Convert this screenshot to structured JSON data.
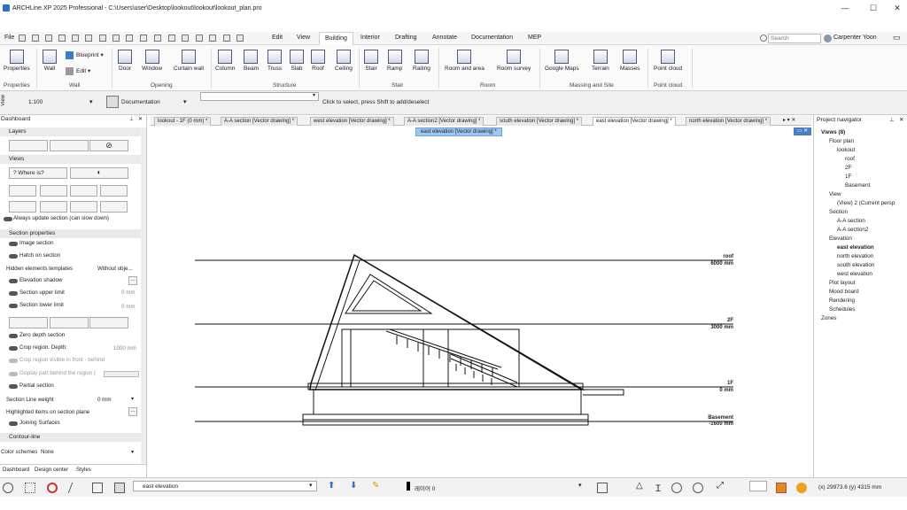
{
  "title": "ARCHLine.XP 2025 Professional - C:\\Users\\user\\Desktop\\lookout\\lookout\\lookout_plan.pro",
  "menu": {
    "file": "File",
    "items": [
      "Edit",
      "View",
      "Building",
      "Interior",
      "Drafting",
      "Annotate",
      "Documentation",
      "MEP"
    ],
    "active": "Building"
  },
  "search": {
    "placeholder": "Search"
  },
  "user": "Carpenter Yoon",
  "ribbon": {
    "buttons": [
      "Properties",
      "Wall",
      "Blueprint",
      "Edit",
      "Door",
      "Window",
      "Curtain wall",
      "Column",
      "Beam",
      "Truss",
      "Slab",
      "Roof",
      "Ceiling",
      "Stair",
      "Ramp",
      "Railing",
      "Room and area",
      "Room survey",
      "Google Maps",
      "Terrain",
      "Masses",
      "Point cloud"
    ],
    "groups": [
      "Properties",
      "Wall",
      "Opening",
      "Structure",
      "Stair",
      "Room",
      "Massing and Site",
      "Point cloud"
    ]
  },
  "viewbar": {
    "side": "View",
    "scale": "1:100",
    "layer": "Documentation",
    "hint": "Click to select, press Shift to add/deselect"
  },
  "left": {
    "title": "Dashboard",
    "layers": "Layers",
    "views": "Views",
    "where_is": "Where is?",
    "always_update": "Always update section (can slow down)",
    "section_properties": "Section properties",
    "image_section": "Image section",
    "hatch_section": "Hatch on section",
    "hidden_templates": "Hidden elements templates",
    "without": "Without obje...",
    "elevation_shadow": "Elevation shadow",
    "upper": "Section upper limit",
    "upper_val": "0 mm",
    "lower": "Section lower limit",
    "lower_val": "0 mm",
    "zero_depth": "Zero depth section",
    "crop_depth": "Crop region. Depth:",
    "crop_val": "1000 mm",
    "crop_visible": "Crop region visible in front - behind",
    "display_part": "Display part behind the region (",
    "partial": "Partial section",
    "line_weight": "Section Line weight",
    "lw_val": "0 mm",
    "highlighted": "Highlighted items on section plane",
    "joining": "Joining Surfaces",
    "contour": "Contour-line",
    "color_schemes": "Color schemes",
    "cs_val": "None",
    "tabs": [
      "Dashboard",
      "Design center",
      "Styles"
    ]
  },
  "doc_tabs": [
    "lookout - 1F (0 mm) *",
    "A-A section [Vector drawing] *",
    "west elevation [Vector drawing] *",
    "A-A section2 [Vector drawing] *",
    "south elevation [Vector drawing] *",
    "east elevation [Vector drawing] *",
    "north elevation [Vector drawing] *"
  ],
  "active_tab_label": "east elevation [Vector drawing] *",
  "levels": [
    {
      "name": "roof",
      "elev": "6000 mm"
    },
    {
      "name": "2F",
      "elev": "3000 mm"
    },
    {
      "name": "1F",
      "elev": "0 mm"
    },
    {
      "name": "Basement",
      "elev": "-1600 mm"
    }
  ],
  "navigator": {
    "title": "Project navigator",
    "items": [
      {
        "label": "Views (8)",
        "bold": true,
        "d": 0
      },
      {
        "label": "Floor plan",
        "d": 1
      },
      {
        "label": "lookout",
        "d": 2
      },
      {
        "label": "roof",
        "d": 3
      },
      {
        "label": "2F",
        "d": 3
      },
      {
        "label": "1F",
        "d": 3
      },
      {
        "label": "Basement",
        "d": 3
      },
      {
        "label": "View",
        "d": 1
      },
      {
        "label": "(View) 2 (Current persp",
        "d": 2
      },
      {
        "label": "Section",
        "d": 1
      },
      {
        "label": "A-A section",
        "d": 2
      },
      {
        "label": "A-A section2",
        "d": 2
      },
      {
        "label": "Elevation",
        "d": 1
      },
      {
        "label": "east elevation",
        "bold": true,
        "d": 2
      },
      {
        "label": "north elevation",
        "d": 2
      },
      {
        "label": "south elevation",
        "d": 2
      },
      {
        "label": "west elevation",
        "d": 2
      },
      {
        "label": "Plot layout",
        "d": 1
      },
      {
        "label": "Mood board",
        "d": 1
      },
      {
        "label": "Rendering",
        "d": 1
      },
      {
        "label": "Schedules",
        "d": 1
      },
      {
        "label": "Zones",
        "d": 0
      }
    ]
  },
  "status": {
    "view": "east elevation",
    "layer": "레이어 0",
    "coords": "(x) 29973.6  (y) 4315 mm"
  }
}
